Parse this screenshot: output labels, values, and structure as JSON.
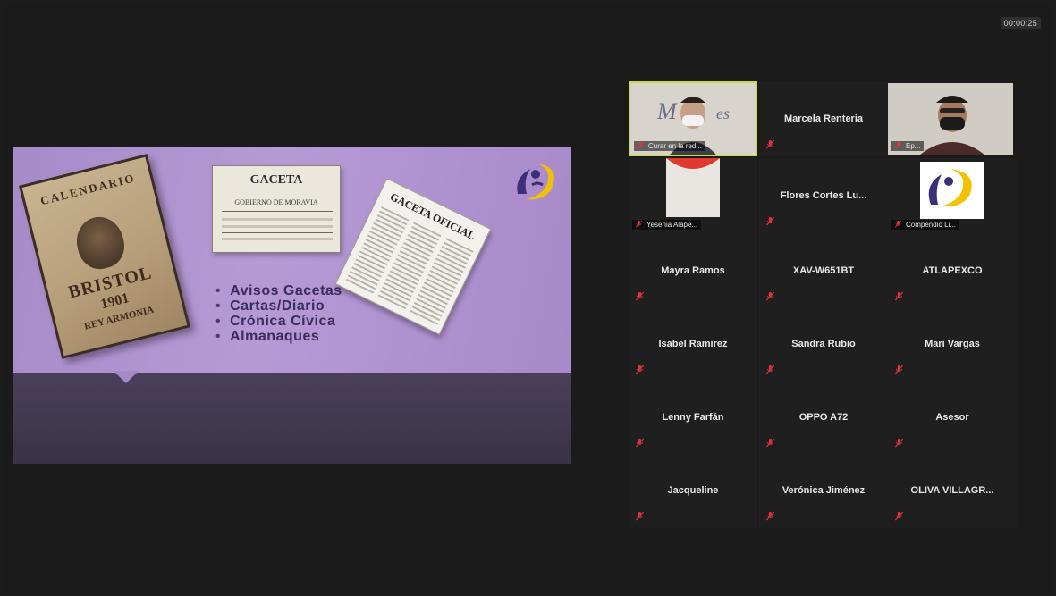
{
  "meeting": {
    "timer": "00:00:25"
  },
  "shared_slide": {
    "poster": {
      "head": "CALENDARIO",
      "title": "BRISTOL",
      "year": "1901",
      "sub": "REY ARMONIA"
    },
    "gaceta": {
      "title": "GACETA",
      "subtitle": "GOBIERNO DE MORAVIA"
    },
    "newspaper": {
      "title": "GACETA OFICIAL"
    },
    "bullets": [
      "Avisos Gacetas",
      "Cartas/Diario",
      "Crónica Cívica",
      "Almanaques"
    ],
    "colors": {
      "slide_purple": "#b69ad6",
      "band_dark": "#3b3447",
      "bullet_text": "#3b2b5c"
    }
  },
  "participants": [
    {
      "name": "Curar en la red...",
      "video": true,
      "active": true,
      "icon": "person-icon"
    },
    {
      "name": "Marcela Renteria",
      "video": false
    },
    {
      "name": "Ep...",
      "video": true,
      "icon": "person-icon"
    },
    {
      "name": "Yesenia Alape...",
      "video": true,
      "icon": "red-circle-icon"
    },
    {
      "name": "Flores Cortes Lu...",
      "video": false
    },
    {
      "name": "Compendio Li...",
      "video": true,
      "icon": "logo-icon"
    },
    {
      "name": "Mayra Ramos",
      "video": false
    },
    {
      "name": "XAV-W651BT",
      "video": false
    },
    {
      "name": "ATLAPEXCO",
      "video": false
    },
    {
      "name": "Isabel Ramirez",
      "video": false
    },
    {
      "name": "Sandra Rubio",
      "video": false
    },
    {
      "name": "Mari Vargas",
      "video": false
    },
    {
      "name": "Lenny Farfán",
      "video": false
    },
    {
      "name": "OPPO A72",
      "video": false
    },
    {
      "name": "Asesor",
      "video": false
    },
    {
      "name": "Jacqueline",
      "video": false
    },
    {
      "name": "Verónica Jiménez",
      "video": false
    },
    {
      "name": "OLIVA VILLAGR...",
      "video": false
    }
  ],
  "ui_colors": {
    "active_speaker_border": "#c8dc3c",
    "muted_icon": "#e0323c",
    "background": "#1c1c1c"
  }
}
